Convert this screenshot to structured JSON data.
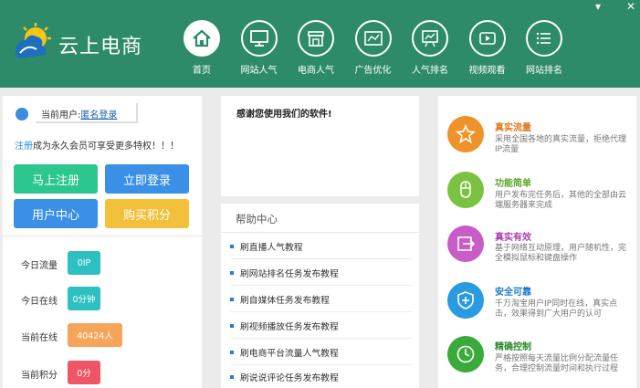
{
  "brand": {
    "name": "云上电商"
  },
  "nav": [
    {
      "label": "首页",
      "icon": "home-icon"
    },
    {
      "label": "网站人气",
      "icon": "monitor-icon"
    },
    {
      "label": "电商人气",
      "icon": "shop-icon"
    },
    {
      "label": "广告优化",
      "icon": "ad-chart-icon"
    },
    {
      "label": "人气排名",
      "icon": "rank-board-icon"
    },
    {
      "label": "视频观看",
      "icon": "video-icon"
    },
    {
      "label": "网站排名",
      "icon": "list-icon"
    }
  ],
  "window": {
    "minimize": "▾",
    "close": "✕"
  },
  "user": {
    "label": "当前用户:",
    "value": "匿名登录"
  },
  "promo": {
    "link": "注册",
    "text": "成为永久会员可享受更多特权！！！"
  },
  "buttons": {
    "register": "马上注册",
    "login": "立即登录",
    "user_center": "用户中心",
    "buy_points": "购买积分"
  },
  "stats": [
    {
      "label": "今日流量",
      "value": "0IP",
      "color": "#2cc0c0"
    },
    {
      "label": "今日在线",
      "value": "0分钟",
      "color": "#2cc0c0"
    },
    {
      "label": "当前在线",
      "value": "40424人",
      "color": "#f5a45a"
    },
    {
      "label": "当前积分",
      "value": "0分",
      "color": "#ef5566"
    }
  ],
  "thanks": "感谢您使用我们的软件!",
  "help": {
    "title": "帮助中心",
    "items": [
      "刷直播人气教程",
      "刷网站排名任务发布教程",
      "刷自媒体任务发布教程",
      "刷视频播放任务发布教程",
      "刷电商平台流量人气教程",
      "刷说说评论任务发布教程"
    ]
  },
  "features": [
    {
      "title": "真实流量",
      "desc": "采用全国各地的真实流量，拒绝代理IP流量",
      "color": "#f0922a",
      "icon": "star-icon"
    },
    {
      "title": "功能简单",
      "desc": "用户发布完任务后，其他的全部由云端服务器来完成",
      "color": "#7cc242",
      "icon": "mouse-icon"
    },
    {
      "title": "真实有效",
      "desc": "基于网络互动原理，用户随机性，完全模拟鼠标和键盘操作",
      "color": "#c85dc8",
      "icon": "exit-icon"
    },
    {
      "title": "安全可靠",
      "desc": "千万淘宝用户IP同时在线，真实点击，效果得到广大用户的认可",
      "color": "#2a9be0",
      "icon": "shield-icon"
    },
    {
      "title": "精确控制",
      "desc": "严格按照每天流量比例分配流量任务，合理控制流量时间和执行过程",
      "color": "#3aaa3a",
      "icon": "clock-icon"
    }
  ]
}
